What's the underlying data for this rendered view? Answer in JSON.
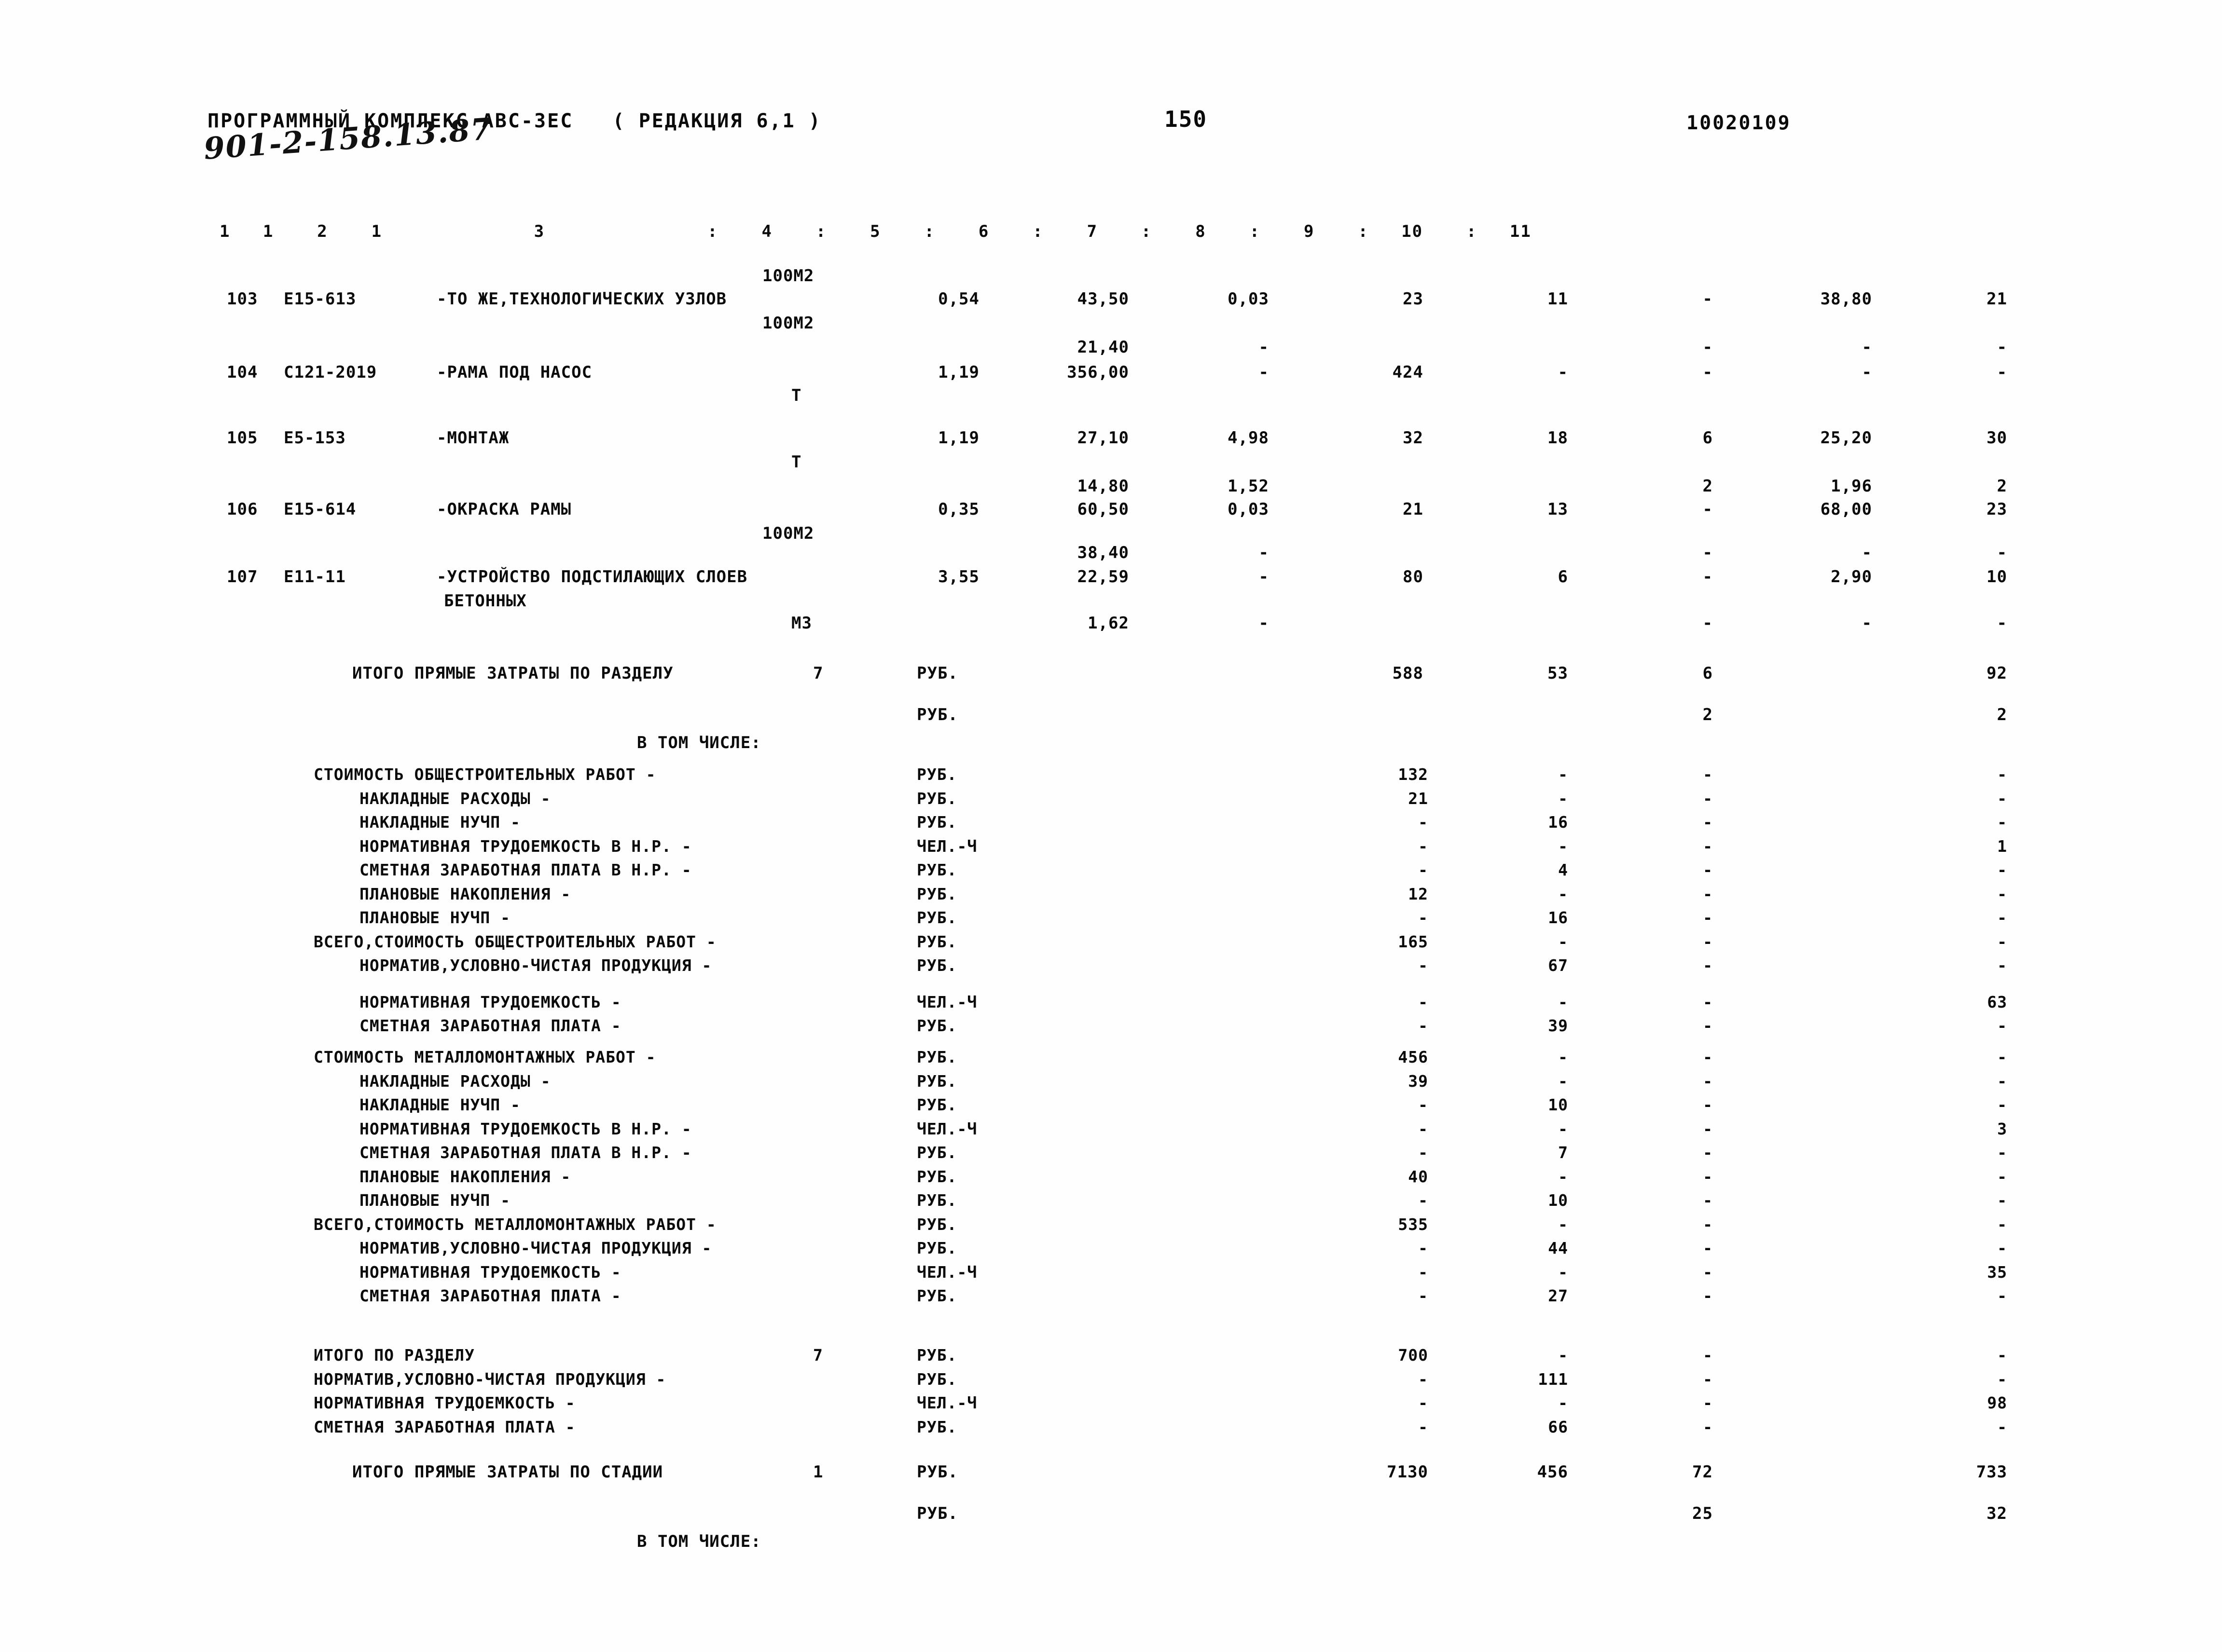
{
  "header": {
    "program_title": "ПРОГРАММНЫЙ КОМПЛЕКС АВС-ЗЕС   ( РЕДАКЦИЯ 6,1 )",
    "page_number": "150",
    "doc_code": "10020109",
    "handwritten_note": "901-2-158.13.87"
  },
  "column_header": "1   1    2    1              3               :    4    :    5    :    6    :    7    :    8    :    9    :   10    :   11",
  "separator": "..............................................................................................................................................",
  "items": [
    {
      "no": "103",
      "code": "Е15-613",
      "name": "-ТО ЖЕ,ТЕХНОЛОГИЧЕСКИХ УЗЛОВ",
      "unit_top": "100М2",
      "unit_bottom": "100М2",
      "c4": "0,54",
      "c5_top": "",
      "c5": "43,50",
      "c6_top": "",
      "c6": "0,03",
      "c7": "23",
      "c8": "11",
      "c9": "-",
      "c10": "38,80",
      "c11": "21"
    },
    {
      "no": "104",
      "code": "С121-2019",
      "name": "-РАМА ПОД НАСОС",
      "unit_top": "",
      "unit_bottom": "Т",
      "c4": "1,19",
      "c5_top": "21,40",
      "c5": "356,00",
      "c6_top": "-",
      "c6": "-",
      "c7": "424",
      "c8": "-",
      "c9": "-",
      "c10": "-",
      "c11": "-"
    },
    {
      "no": "105",
      "code": "Е5-153",
      "name": "-МОНТАЖ",
      "unit_top": "",
      "unit_bottom": "Т",
      "c4": "1,19",
      "c5_top": "",
      "c5": "27,10",
      "c6_top": "",
      "c6": "4,98",
      "c7": "32",
      "c8": "18",
      "c9": "6",
      "c10": "25,20",
      "c11": "30"
    },
    {
      "no": "106",
      "code": "Е15-614",
      "name": "-ОКРАСКА РАМЫ",
      "unit_top": "",
      "unit_bottom": "100М2",
      "c4": "0,35",
      "c5_top": "14,80",
      "c5": "60,50",
      "c6_top": "1,52",
      "c6": "0,03",
      "c7": "21",
      "c8": "13",
      "c9_top": "2",
      "c9": "-",
      "c10_top": "1,96",
      "c10": "68,00",
      "c11_top": "2",
      "c11": "23"
    },
    {
      "no": "107",
      "code": "Е11-11",
      "name": "-УСТРОЙСТВО ПОДСТИЛАЮЩИХ СЛОЕВ",
      "name2": "БЕТОННЫХ",
      "unit_top": "",
      "unit_bottom": "М3",
      "c4": "3,55",
      "c5_top": "38,40",
      "c5": "22,59",
      "c5_extra": "1,62",
      "c6_top": "-",
      "c6": "-",
      "c6_extra": "-",
      "c7": "80",
      "c8": "6",
      "c9": "-",
      "c9_extra": "-",
      "c10": "2,90",
      "c10_extra": "-",
      "c11": "10",
      "c11_extra": "-"
    }
  ],
  "section_total": {
    "label": "ИТОГО ПРЯМЫЕ ЗАТРАТЫ ПО РАЗДЕЛУ",
    "section_no": "7",
    "unit": "РУБ.",
    "unit2": "РУБ.",
    "c7": "588",
    "c8": "53",
    "c9": "6",
    "c11": "92",
    "c9_b": "2",
    "c11_b": "2",
    "in_which": "В ТОМ ЧИСЛЕ:"
  },
  "general_block": [
    {
      "label": "СТОИМОСТЬ ОБЩЕСТРОИТЕЛЬНЫХ РАБОТ -",
      "indent": 0,
      "unit": "РУБ.",
      "c7": "132",
      "c8": "-",
      "c9": "-",
      "c11": "-"
    },
    {
      "label": "НАКЛАДНЫЕ РАСХОДЫ -",
      "indent": 1,
      "unit": "РУБ.",
      "c7": "21",
      "c8": "-",
      "c9": "-",
      "c11": "-"
    },
    {
      "label": "НАКЛАДНЫЕ НУЧП -",
      "indent": 1,
      "unit": "РУБ.",
      "c7": "-",
      "c8": "16",
      "c9": "-",
      "c11": "-"
    },
    {
      "label": "НОРМАТИВНАЯ ТРУДОЕМКОСТЬ В Н.Р. -",
      "indent": 1,
      "unit": "ЧЕЛ.-Ч",
      "c7": "-",
      "c8": "-",
      "c9": "-",
      "c11": "1"
    },
    {
      "label": "СМЕТНАЯ ЗАРАБОТНАЯ ПЛАТА В Н.Р. -",
      "indent": 1,
      "unit": "РУБ.",
      "c7": "-",
      "c8": "4",
      "c9": "-",
      "c11": "-"
    },
    {
      "label": "ПЛАНОВЫЕ НАКОПЛЕНИЯ -",
      "indent": 1,
      "unit": "РУБ.",
      "c7": "12",
      "c8": "-",
      "c9": "-",
      "c11": "-"
    },
    {
      "label": "ПЛАНОВЫЕ НУЧП -",
      "indent": 1,
      "unit": "РУБ.",
      "c7": "-",
      "c8": "16",
      "c9": "-",
      "c11": "-"
    },
    {
      "label": "ВСЕГО,СТОИМОСТЬ ОБЩЕСТРОИТЕЛЬНЫХ РАБОТ -",
      "indent": 0,
      "unit": "РУБ.",
      "c7": "165",
      "c8": "-",
      "c9": "-",
      "c11": "-"
    },
    {
      "label": "НОРМАТИВ,УСЛОВНО-ЧИСТАЯ ПРОДУКЦИЯ -",
      "indent": 1,
      "unit": "РУБ.",
      "c7": "-",
      "c8": "67",
      "c9": "-",
      "c11": "-"
    },
    {
      "label": "НОРМАТИВНАЯ ТРУДОЕМКОСТЬ -",
      "indent": 1,
      "unit": "ЧЕЛ.-Ч",
      "c7": "-",
      "c8": "-",
      "c9": "-",
      "c11": "63",
      "gap": true
    },
    {
      "label": "СМЕТНАЯ ЗАРАБОТНАЯ ПЛАТА -",
      "indent": 1,
      "unit": "РУБ.",
      "c7": "-",
      "c8": "39",
      "c9": "-",
      "c11": "-"
    }
  ],
  "metal_block": [
    {
      "label": "СТОИМОСТЬ МЕТАЛЛОМОНТАЖНЫХ РАБОТ -",
      "indent": 0,
      "unit": "РУБ.",
      "c7": "456",
      "c8": "-",
      "c9": "-",
      "c11": "-"
    },
    {
      "label": "НАКЛАДНЫЕ РАСХОДЫ -",
      "indent": 1,
      "unit": "РУБ.",
      "c7": "39",
      "c8": "-",
      "c9": "-",
      "c11": "-"
    },
    {
      "label": "НАКЛАДНЫЕ НУЧП -",
      "indent": 1,
      "unit": "РУБ.",
      "c7": "-",
      "c8": "10",
      "c9": "-",
      "c11": "-"
    },
    {
      "label": "НОРМАТИВНАЯ ТРУДОЕМКОСТЬ В Н.Р. -",
      "indent": 1,
      "unit": "ЧЕЛ.-Ч",
      "c7": "-",
      "c8": "-",
      "c9": "-",
      "c11": "3"
    },
    {
      "label": "СМЕТНАЯ ЗАРАБОТНАЯ ПЛАТА В Н.Р. -",
      "indent": 1,
      "unit": "РУБ.",
      "c7": "-",
      "c8": "7",
      "c9": "-",
      "c11": "-"
    },
    {
      "label": "ПЛАНОВЫЕ НАКОПЛЕНИЯ -",
      "indent": 1,
      "unit": "РУБ.",
      "c7": "40",
      "c8": "-",
      "c9": "-",
      "c11": "-"
    },
    {
      "label": "ПЛАНОВЫЕ НУЧП -",
      "indent": 1,
      "unit": "РУБ.",
      "c7": "-",
      "c8": "10",
      "c9": "-",
      "c11": "-"
    },
    {
      "label": "ВСЕГО,СТОИМОСТЬ МЕТАЛЛОМОНТАЖНЫХ РАБОТ -",
      "indent": 0,
      "unit": "РУБ.",
      "c7": "535",
      "c8": "-",
      "c9": "-",
      "c11": "-"
    },
    {
      "label": "НОРМАТИВ,УСЛОВНО-ЧИСТАЯ ПРОДУКЦИЯ -",
      "indent": 1,
      "unit": "РУБ.",
      "c7": "-",
      "c8": "44",
      "c9": "-",
      "c11": "-"
    },
    {
      "label": "НОРМАТИВНАЯ ТРУДОЕМКОСТЬ -",
      "indent": 1,
      "unit": "ЧЕЛ.-Ч",
      "c7": "-",
      "c8": "-",
      "c9": "-",
      "c11": "35"
    },
    {
      "label": "СМЕТНАЯ ЗАРАБОТНАЯ ПЛАТА -",
      "indent": 1,
      "unit": "РУБ.",
      "c7": "-",
      "c8": "27",
      "c9": "-",
      "c11": "-"
    }
  ],
  "section_summary": [
    {
      "label": "ИТОГО ПО РАЗДЕЛУ",
      "section_no": "7",
      "unit": "РУБ.",
      "c7": "700",
      "c8": "-",
      "c9": "-",
      "c11": "-"
    },
    {
      "label": "НОРМАТИВ,УСЛОВНО-ЧИСТАЯ ПРОДУКЦИЯ -",
      "unit": "РУБ.",
      "c7": "-",
      "c8": "111",
      "c9": "-",
      "c11": "-"
    },
    {
      "label": "НОРМАТИВНАЯ ТРУДОЕМКОСТЬ -",
      "unit": "ЧЕЛ.-Ч",
      "c7": "-",
      "c8": "-",
      "c9": "-",
      "c11": "98"
    },
    {
      "label": "СМЕТНАЯ ЗАРАБОТНАЯ ПЛАТА -",
      "unit": "РУБ.",
      "c7": "-",
      "c8": "66",
      "c9": "-",
      "c11": "-"
    }
  ],
  "grand_total": {
    "label": "ИТОГО ПРЯМЫЕ ЗАТРАТЫ ПО СТАДИИ",
    "stage_no": "1",
    "unit": "РУБ.",
    "unit2": "РУБ.",
    "c7": "7130",
    "c8": "456",
    "c9": "72",
    "c11": "733",
    "c9_b": "25",
    "c11_b": "32",
    "in_which": "В ТОМ ЧИСЛЕ:"
  }
}
